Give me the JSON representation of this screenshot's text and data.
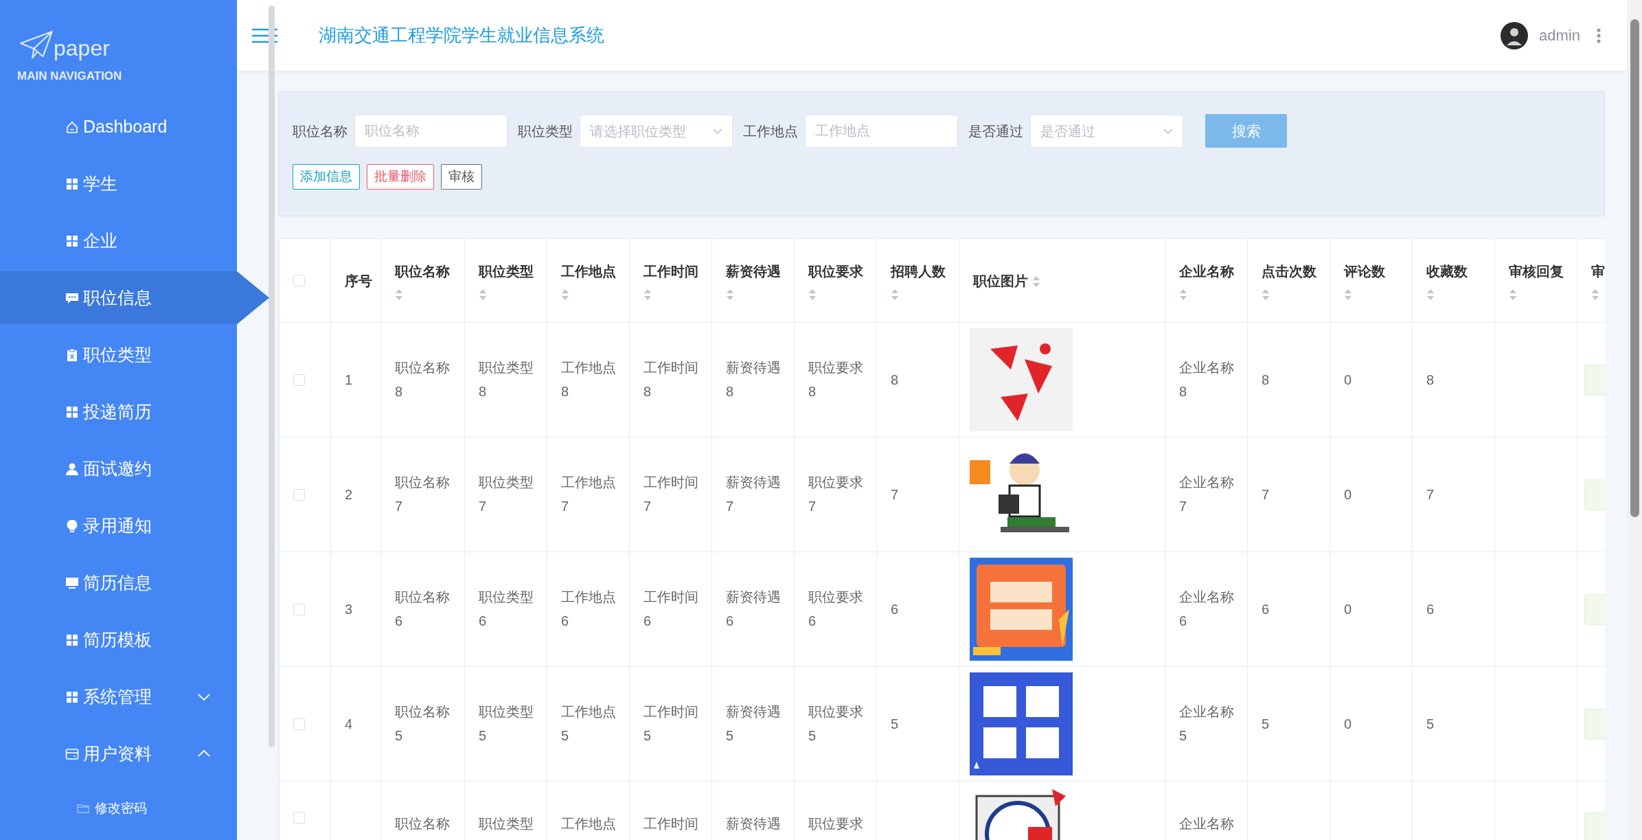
{
  "logo": {
    "text": "paper"
  },
  "sidebar": {
    "section_title": "MAIN NAVIGATION",
    "items": [
      {
        "label": "Dashboard",
        "selected": false
      },
      {
        "label": "学生",
        "selected": false
      },
      {
        "label": "企业",
        "selected": false
      },
      {
        "label": "职位信息",
        "selected": true
      },
      {
        "label": "职位类型",
        "selected": false
      },
      {
        "label": "投递简历",
        "selected": false
      },
      {
        "label": "面试邀约",
        "selected": false
      },
      {
        "label": "录用通知",
        "selected": false
      },
      {
        "label": "简历信息",
        "selected": false
      },
      {
        "label": "简历模板",
        "selected": false
      },
      {
        "label": "系统管理",
        "selected": false,
        "expanded": false
      },
      {
        "label": "用户资料",
        "selected": false,
        "expanded": true,
        "children": [
          {
            "label": "修改密码",
            "selected": false
          }
        ]
      }
    ]
  },
  "header": {
    "title": "湖南交通工程学院学生就业信息系统",
    "user": "admin"
  },
  "search": {
    "fields": [
      {
        "label": "职位名称",
        "kind": "input",
        "placeholder": "职位名称"
      },
      {
        "label": "职位类型",
        "kind": "select",
        "placeholder": "请选择职位类型"
      },
      {
        "label": "工作地点",
        "kind": "input",
        "placeholder": "工作地点"
      },
      {
        "label": "是否通过",
        "kind": "select",
        "placeholder": "是否通过"
      }
    ],
    "search_button": "搜索",
    "actions": [
      {
        "label": "添加信息",
        "kind": "info"
      },
      {
        "label": "批量删除",
        "kind": "danger"
      },
      {
        "label": "审核",
        "kind": "secondary"
      }
    ]
  },
  "table": {
    "select_all": {
      "checked": false
    },
    "columns": [
      {
        "label": "序号",
        "sortable": false,
        "kind": "text"
      },
      {
        "label": "职位名称",
        "sortable": true,
        "kind": "text"
      },
      {
        "label": "职位类型",
        "sortable": true,
        "kind": "text"
      },
      {
        "label": "工作地点",
        "sortable": true,
        "kind": "text"
      },
      {
        "label": "工作时间",
        "sortable": true,
        "kind": "text"
      },
      {
        "label": "薪资待遇",
        "sortable": true,
        "kind": "text"
      },
      {
        "label": "职位要求",
        "sortable": true,
        "kind": "text"
      },
      {
        "label": "招聘人数",
        "sortable": true,
        "kind": "text"
      },
      {
        "label": "职位图片",
        "sortable": true
      },
      {
        "label": "企业名称",
        "sortable": true,
        "kind": "text"
      },
      {
        "label": "点击次数",
        "sortable": true,
        "kind": "text"
      },
      {
        "label": "评论数",
        "sortable": true,
        "kind": "text"
      },
      {
        "label": "收藏数",
        "sortable": true,
        "kind": "text"
      },
      {
        "label": "审核回复",
        "sortable": true,
        "kind": "text"
      },
      {
        "label": "审",
        "sortable": true,
        "kind": "tag"
      }
    ],
    "rows": [
      {
        "checked": false,
        "cells": [
          "1",
          "职位名称8",
          "职位类型8",
          "工作地点8",
          "工作时间8",
          "薪资待遇8",
          "职位要求8",
          "8",
          {
            "kind": "picture"
          },
          "企业名称8",
          "8",
          "0",
          "8",
          "",
          {
            "passed": true
          }
        ]
      },
      {
        "checked": false,
        "cells": [
          "2",
          "职位名称7",
          "职位类型7",
          "工作地点7",
          "工作时间7",
          "薪资待遇7",
          "职位要求7",
          "7",
          {
            "kind": "picture"
          },
          "企业名称7",
          "7",
          "0",
          "7",
          "",
          {
            "passed": true
          }
        ]
      },
      {
        "checked": false,
        "cells": [
          "3",
          "职位名称6",
          "职位类型6",
          "工作地点6",
          "工作时间6",
          "薪资待遇6",
          "职位要求6",
          "6",
          {
            "kind": "picture"
          },
          "企业名称6",
          "6",
          "0",
          "6",
          "",
          {
            "passed": true
          }
        ]
      },
      {
        "checked": false,
        "cells": [
          "4",
          "职位名称5",
          "职位类型5",
          "工作地点5",
          "工作时间5",
          "薪资待遇5",
          "职位要求5",
          "5",
          {
            "kind": "picture"
          },
          "企业名称5",
          "5",
          "0",
          "5",
          "",
          {
            "passed": true
          }
        ]
      },
      {
        "checked": false,
        "cells": [
          "",
          "职位名称",
          "职位类型",
          "工作地点",
          "工作时间",
          "薪资待遇",
          "职位要求",
          "",
          {
            "kind": "picture"
          },
          "企业名称",
          "",
          "",
          "",
          "",
          {
            "passed": true
          }
        ]
      }
    ]
  }
}
